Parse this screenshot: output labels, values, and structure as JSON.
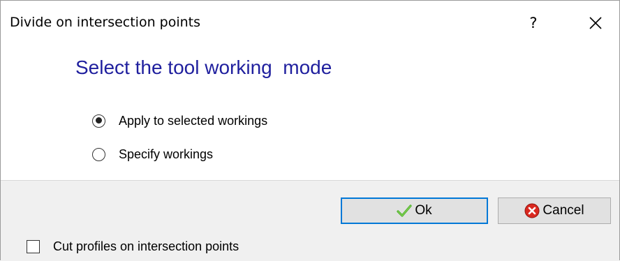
{
  "window": {
    "title": "Divide on intersection points",
    "help_label": "?",
    "close_icon": "close-icon"
  },
  "content": {
    "heading": "Select the tool working  mode",
    "mode_options": [
      {
        "label": "Apply to selected workings",
        "selected": true
      },
      {
        "label": "Specify workings",
        "selected": false
      }
    ]
  },
  "footer": {
    "ok_label": "Ok",
    "ok_icon": "checkmark-icon",
    "cancel_label": "Cancel",
    "cancel_icon": "cancel-x-icon",
    "cut_profiles_label": "Cut profiles on intersection points",
    "cut_profiles_checked": false
  },
  "colors": {
    "heading": "#1f1f9e",
    "ok_border": "#0078d7",
    "footer_bg": "#f0f0f0",
    "button_bg": "#e1e1e1"
  }
}
